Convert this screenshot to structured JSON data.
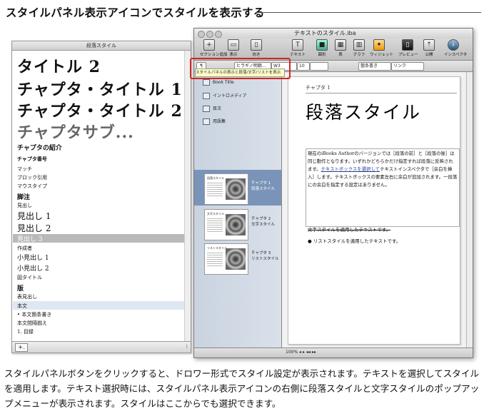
{
  "heading": "スタイルパネル表示アイコンでスタイルを表示する",
  "caption": "スタイルパネルボタンをクリックすると、ドロワー形式でスタイル設定が表示されます。テキストを選択してスタイルを適用します。テキスト選択時には、スタイルパネル表示アイコンの右側に段落スタイルと文字スタイルのポップアップメニューが表示されます。スタイルはここからでも選択できます。",
  "drawer": {
    "title": "段落スタイル",
    "large_items": [
      "タイトル 2",
      "チャプタ・タイトル 1",
      "チャプタ・タイトル 2",
      "チャプタサブ..."
    ],
    "items": [
      "チャプタの紹介",
      "チャプタ番号",
      "マッチ",
      "ブロック引用",
      "マウスタイプ",
      "脚注",
      "見出し",
      "見出し 1",
      "見出し 2",
      "見出し 3",
      "作成者",
      "小見出し 1",
      "小見出し 2",
      "図タイトル",
      "版",
      "表見出し",
      "本文",
      "• 本文箇条書き",
      "本文間隔揃え",
      "1. 目録"
    ],
    "add_label": "+.",
    "grip": "⁞"
  },
  "window": {
    "title": "テキストのスタイル.iba",
    "toolbar": [
      "セクション追加",
      "表示",
      "向き",
      "テキスト",
      "図形",
      "表",
      "グラフ",
      "ウィジェット",
      "プレビュー",
      "公開",
      "インスペクタ"
    ],
    "format": {
      "style_icon": "¶",
      "font": "ヒラギノ明朝...",
      "weight": "W3",
      "size": "10",
      "list": "箇条書き",
      "char": "リンク"
    },
    "tooltip": "スタイルパネルの表示と段落/文字/リストを表示",
    "sidebar": {
      "items": [
        "Book Title",
        "イントロメディア",
        "目次",
        "用語集"
      ],
      "thumbs": [
        {
          "title": "段落スタイル",
          "label1": "チャプタ 1",
          "label2": "段落スタイル"
        },
        {
          "title": "文字スタイル",
          "label1": "チャプタ 2",
          "label2": "文字スタイル"
        },
        {
          "title": "リストスタイル",
          "label1": "チャプタ 3",
          "label2": "リストスタイル"
        }
      ]
    },
    "page": {
      "chapter_label": "チャプタ 1",
      "title": "段落スタイル",
      "body_a": "現在のiBooks Authorのバージョンでは［段落の前］と［段落の後］は同じ動作となります。いずれかどちらかだけ指定すれば段落に反映されます。",
      "body_link": "テキストボックスを選択して",
      "body_b": "テキストインスペクタで［余白を挿入］します。テキストボックスの要素左右に余白が追加されます。一段落にの余白を指定する設定はありません。",
      "char_line": "文字スタイルを適用したテキストです。",
      "list_line": "リストスタイルを適用したテキストです。"
    },
    "zoom": "100% ◂ ▸ ◂◂ ▸▸"
  }
}
